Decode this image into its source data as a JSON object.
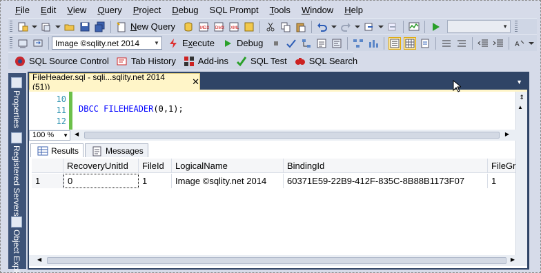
{
  "menu": [
    {
      "pre": "",
      "u": "F",
      "post": "ile"
    },
    {
      "pre": "",
      "u": "E",
      "post": "dit"
    },
    {
      "pre": "",
      "u": "V",
      "post": "iew"
    },
    {
      "pre": "",
      "u": "Q",
      "post": "uery"
    },
    {
      "pre": "",
      "u": "P",
      "post": "roject"
    },
    {
      "pre": "",
      "u": "D",
      "post": "ebug"
    },
    {
      "pre": "SQL Prompt",
      "u": "",
      "post": ""
    },
    {
      "pre": "",
      "u": "T",
      "post": "ools"
    },
    {
      "pre": "",
      "u": "W",
      "post": "indow"
    },
    {
      "pre": "",
      "u": "H",
      "post": "elp"
    }
  ],
  "toolbar1": {
    "new_query_u": "N",
    "new_query_rest": "ew Query"
  },
  "toolbar2": {
    "database_value": "Image ©sqlity.net 2014",
    "execute_u": "x",
    "execute_pre": "E",
    "execute_post": "ecute",
    "debug_label": "Debug"
  },
  "toolbar3": {
    "source_control": "SQL Source Control",
    "tab_history": "Tab History",
    "addins": "Add-ins",
    "sql_test": "SQL Test",
    "sql_search": "SQL Search"
  },
  "side_panels": [
    "Properties",
    "Registered Servers",
    "Object Explorer"
  ],
  "document_tab": {
    "title": "FileHeader.sql - sqli...sqlity.net 2014 (51))",
    "close": "✕"
  },
  "editor": {
    "line_numbers": [
      "10",
      "11",
      "12"
    ],
    "code_keyword": "DBCC FILEHEADER",
    "code_rest": "(0,1);"
  },
  "zoom": "100 %",
  "results_tabs": [
    "Results",
    "Messages"
  ],
  "grid": {
    "columns": [
      "",
      "RecoveryUnitId",
      "FileId",
      "LogicalName",
      "BindingId",
      "FileGro"
    ],
    "rows": [
      [
        "1",
        "0",
        "1",
        "Image ©sqlity.net 2014",
        "60371E59-22B9-412F-835C-8B88B1173F07",
        "1"
      ]
    ]
  },
  "colors": {
    "menubar": "#d6dbe9",
    "side_strip": "#3d5378",
    "doc_tab": "#fff5c8",
    "keyword": "#0000ff",
    "line_numbers": "#2b91af",
    "changed_line": "#6cc04a"
  }
}
